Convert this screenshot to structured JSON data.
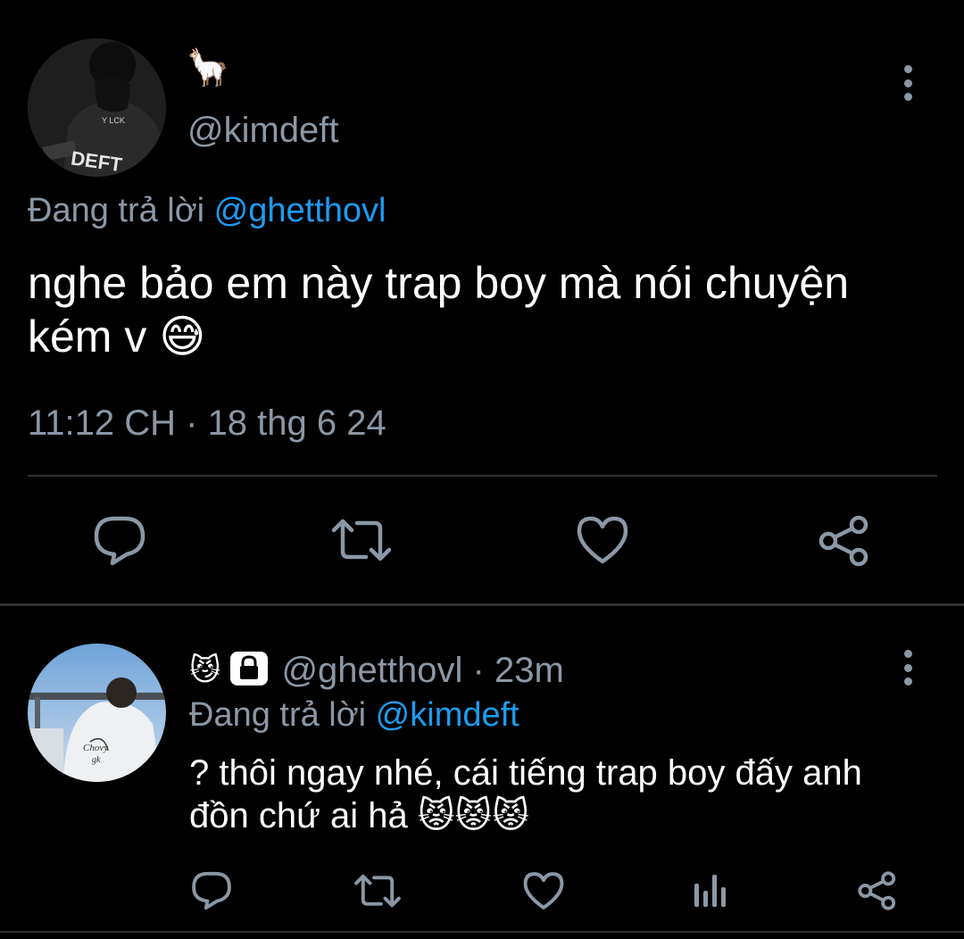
{
  "main_tweet": {
    "display_name_emoji": "🦙",
    "handle": "@kimdeft",
    "avatar_label": "DEFT",
    "replying_prefix": "Đang trả lời ",
    "replying_to": "@ghetthovl",
    "text": "nghe bảo em này trap boy mà nói chuyện kém v 😅",
    "timestamp": "11:12 CH · 18 thg 6 24"
  },
  "reply_tweet": {
    "display_name_emoji": "😼",
    "handle_meta": "@ghetthovl · 23m",
    "replying_prefix": "Đang trả lời ",
    "replying_to": "@kimdeft",
    "text": "? thôi ngay nhé, cái tiếng trap boy đấy anh đồn chứ ai hả 😾😾😾"
  },
  "icons": {
    "main_actions": [
      "reply-icon",
      "retweet-icon",
      "like-icon",
      "share-icon"
    ],
    "reply_actions": [
      "reply-icon",
      "retweet-icon",
      "like-icon",
      "analytics-icon",
      "share-icon"
    ],
    "more": "more-vertical-icon",
    "protected": "lock-icon"
  },
  "colors": {
    "background": "#000000",
    "text": "#ffffff",
    "secondary": "#8b98a5",
    "link": "#1d9bf0",
    "divider": "#2f3336"
  }
}
